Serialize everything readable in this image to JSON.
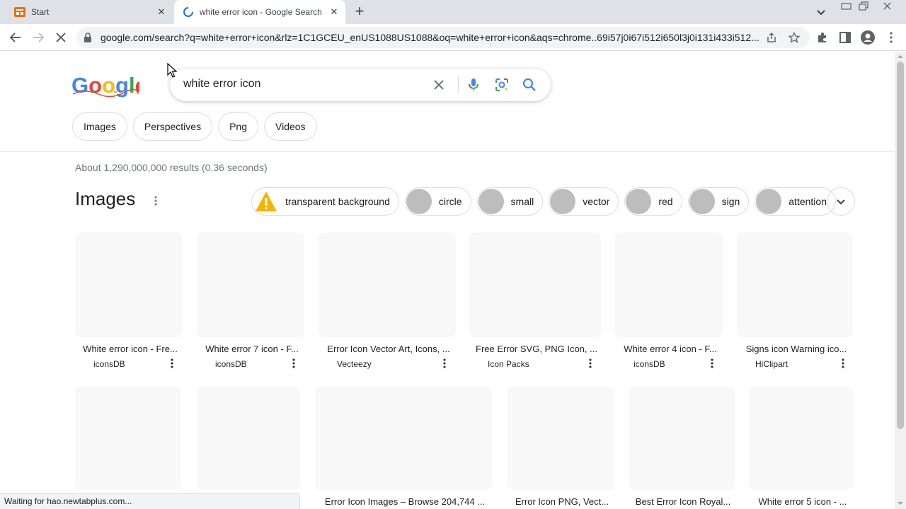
{
  "browser": {
    "tabs": [
      {
        "title": "Start"
      },
      {
        "title": "white error icon - Google Search"
      }
    ],
    "url": "google.com/search?q=white+error+icon&rlz=1C1GCEU_enUS1088US1088&oq=white+error+icon&aqs=chrome..69i57j0i67i512i650l3j0i131i433i512...",
    "status_text": "Waiting for hao.newtabplus.com..."
  },
  "search": {
    "query": "white error icon",
    "filter_chips": [
      "Images",
      "Perspectives",
      "Png",
      "Videos"
    ],
    "result_stats": "About 1,290,000,000 results (0.36 seconds)"
  },
  "images": {
    "heading": "Images",
    "refinements": [
      {
        "label": "transparent background",
        "thumb": "warning-triangle"
      },
      {
        "label": "circle",
        "thumb": "gray"
      },
      {
        "label": "small",
        "thumb": "gray"
      },
      {
        "label": "vector",
        "thumb": "gray"
      },
      {
        "label": "red",
        "thumb": "gray"
      },
      {
        "label": "sign",
        "thumb": "gray"
      },
      {
        "label": "attention",
        "thumb": "gray"
      }
    ],
    "row1": [
      {
        "caption": "White error icon - Fre...",
        "source": "iconsDB"
      },
      {
        "caption": "White error 7 icon - F...",
        "source": "iconsDB"
      },
      {
        "caption": "Error Icon Vector Art, Icons, ...",
        "source": "Vecteezy"
      },
      {
        "caption": "Free Error SVG, PNG Icon, ...",
        "source": "Icon Packs"
      },
      {
        "caption": "White error 4 icon - F...",
        "source": "iconsDB"
      },
      {
        "caption": "Signs icon Warning ico...",
        "source": "HiClipart"
      }
    ],
    "row2": [
      {
        "caption": "",
        "source": ""
      },
      {
        "caption": "",
        "source": ""
      },
      {
        "caption": "Error Icon Images – Browse 204,744 ...",
        "source": ""
      },
      {
        "caption": "Error Icon PNG, Vect...",
        "source": ""
      },
      {
        "caption": "Best Error Icon Royal...",
        "source": ""
      },
      {
        "caption": "White error 5 icon - ...",
        "source": ""
      }
    ]
  },
  "colors": {
    "google_blue": "#4285f4",
    "google_red": "#ea4335",
    "google_yellow": "#fbbc05",
    "google_green": "#34a853",
    "chrome_frame": "#dee1e6"
  },
  "icons": [
    "start-favicon",
    "google-favicon-loading",
    "close-icon",
    "plus-icon",
    "chevron-down-icon",
    "minimize-icon",
    "restore-icon",
    "back-icon",
    "forward-icon",
    "stop-icon",
    "lock-icon",
    "share-icon",
    "star-icon",
    "extensions-icon",
    "side-panel-icon",
    "profile-icon",
    "more-vert-icon",
    "clear-icon",
    "mic-icon",
    "lens-icon",
    "search-icon",
    "warning-icon"
  ]
}
